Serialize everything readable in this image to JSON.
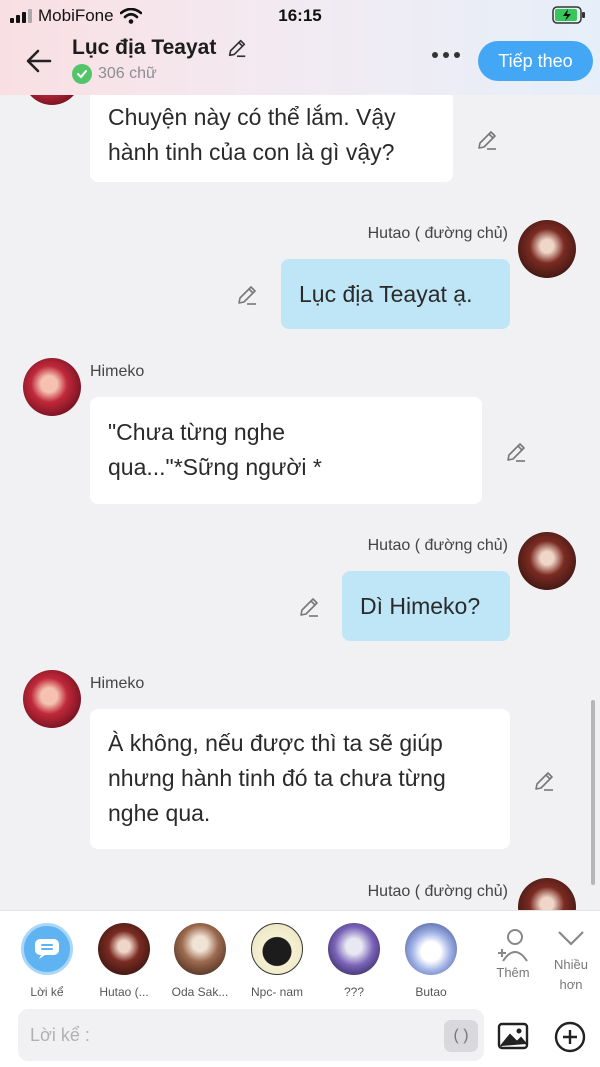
{
  "status_bar": {
    "carrier": "MobiFone",
    "time": "16:15"
  },
  "header": {
    "title": "Lục địa Teayat",
    "word_count": "306 chữ",
    "next_label": "Tiếp theo"
  },
  "messages": [
    {
      "speaker": "Himeko",
      "side": "left",
      "text_lines": [
        "Chuyện này có thể lắm. Vậy",
        "hành tinh của con là gì vậy?"
      ]
    },
    {
      "speaker": "Hutao ( đường chủ)",
      "side": "right",
      "text_lines": [
        "Lục địa Teayat ạ."
      ]
    },
    {
      "speaker": "Himeko",
      "side": "left",
      "text_lines": [
        "\"Chưa từng nghe",
        "qua...\"*Sững người *"
      ]
    },
    {
      "speaker": "Hutao ( đường chủ)",
      "side": "right",
      "text_lines": [
        "Dì Himeko?"
      ]
    },
    {
      "speaker": "Himeko",
      "side": "left",
      "text_lines": [
        "À không, nếu được thì ta sẽ giúp",
        "nhưng hành tinh đó ta chưa từng",
        "nghe qua."
      ]
    },
    {
      "speaker": "Hutao ( đường chủ)",
      "side": "right",
      "text_lines": []
    }
  ],
  "characters": [
    {
      "label": "Lời kể",
      "icon": "narrator-icon"
    },
    {
      "label": "Hutao (..."
    },
    {
      "label": "Oda Sak..."
    },
    {
      "label": "Npc- nam"
    },
    {
      "label": "???"
    },
    {
      "label": "Butao"
    }
  ],
  "char_actions": {
    "add_label": "Thêm",
    "more_label_1": "Nhiều",
    "more_label_2": "hơn"
  },
  "input": {
    "placeholder": "Lời kể :",
    "paren_label": "( )"
  },
  "colors": {
    "accent": "#44a7f5",
    "right_bubble": "#bfe6f7",
    "left_bubble": "#ffffff",
    "check": "#54c46a"
  }
}
